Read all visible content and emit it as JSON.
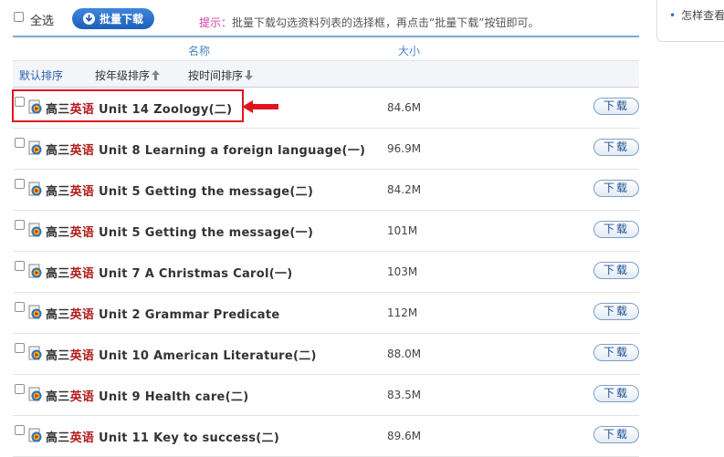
{
  "toolbar": {
    "select_all_label": "全选",
    "batch_download_label": "批量下载",
    "hint_label": "提示：",
    "hint_text": "批量下载勾选资料列表的选择框，再点击“批量下载”按钮即可。"
  },
  "right_panel": {
    "link_text": "怎样查看"
  },
  "table": {
    "col_name": "名称",
    "col_size": "大小",
    "sort_default": "默认排序",
    "sort_grade": "按年级排序",
    "sort_time": "按时间排序",
    "download_label": "下载",
    "rows": [
      {
        "grade": "高三",
        "subject": "英语",
        "title": "Unit 14 Zoology(二)",
        "size": "84.6M"
      },
      {
        "grade": "高三",
        "subject": "英语",
        "title": "Unit 8 Learning a foreign language(一)",
        "size": "96.9M"
      },
      {
        "grade": "高三",
        "subject": "英语",
        "title": "Unit 5 Getting the message(二)",
        "size": "84.2M"
      },
      {
        "grade": "高三",
        "subject": "英语",
        "title": "Unit 5 Getting the message(一)",
        "size": "101M"
      },
      {
        "grade": "高三",
        "subject": "英语",
        "title": "Unit 7 A Christmas Carol(一)",
        "size": "103M"
      },
      {
        "grade": "高三",
        "subject": "英语",
        "title": "Unit 2 Grammar Predicate",
        "size": "112M"
      },
      {
        "grade": "高三",
        "subject": "英语",
        "title": "Unit 10 American Literature(二)",
        "size": "88.0M"
      },
      {
        "grade": "高三",
        "subject": "英语",
        "title": "Unit 9 Health care(二)",
        "size": "83.5M"
      },
      {
        "grade": "高三",
        "subject": "英语",
        "title": "Unit 11 Key to success(二)",
        "size": "89.6M"
      }
    ]
  },
  "colors": {
    "accent_blue": "#1c5fb8",
    "subject_red": "#b01b1b",
    "highlight_red": "#e0141e",
    "hint_pink": "#d23ca0"
  }
}
